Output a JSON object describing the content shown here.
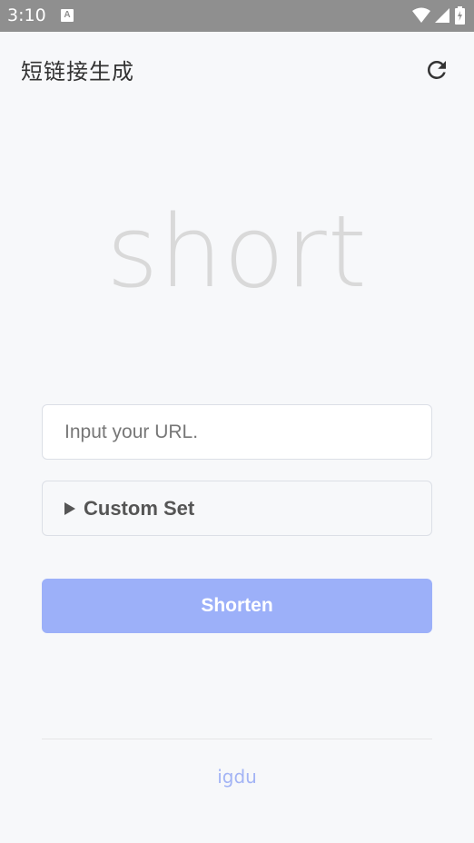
{
  "status_bar": {
    "time": "3:10",
    "notification_icon": "A"
  },
  "app_bar": {
    "title": "短链接生成",
    "refresh_icon": "refresh-icon"
  },
  "hero": {
    "text": "short"
  },
  "form": {
    "url_placeholder": "Input your URL.",
    "url_value": "",
    "custom_set_label": "Custom Set",
    "shorten_label": "Shorten"
  },
  "footer": {
    "link_text": "igdu"
  },
  "colors": {
    "primary_button": "#9cb0f9",
    "link": "#a3b4f5",
    "status_bar": "#8f8f8f"
  }
}
